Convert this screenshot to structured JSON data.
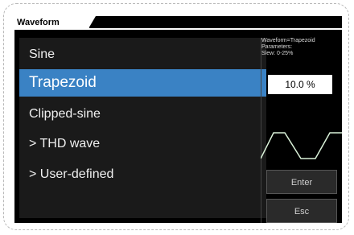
{
  "header": {
    "tab_label": "Waveform"
  },
  "menu": {
    "items": [
      {
        "label": "Sine",
        "selected": false
      },
      {
        "label": "Trapezoid",
        "selected": true
      },
      {
        "label": "Clipped-sine",
        "selected": false
      },
      {
        "label": "> THD wave",
        "selected": false
      },
      {
        "label": "> User-defined",
        "selected": false
      }
    ]
  },
  "side_panel": {
    "info_line1": "Waveform=Trapezoid",
    "info_line2": "Parameters:",
    "info_line3": "Slew: 0-25%",
    "value": "10.0 %",
    "enter_label": "Enter",
    "esc_label": "Esc"
  },
  "colors": {
    "selected": "#3a82c4",
    "wave": "#d9f1d8"
  }
}
